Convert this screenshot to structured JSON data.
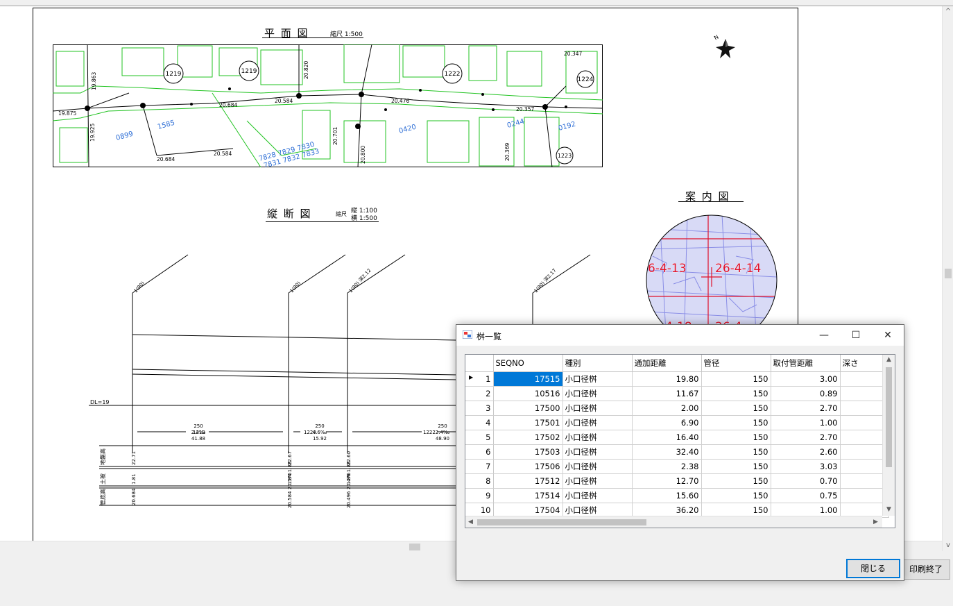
{
  "plan": {
    "title": "平 面 図",
    "scale": "縮尺 1:500",
    "parcels": [
      "1219",
      "1219",
      "1222",
      "1224",
      "1223",
      "1585",
      "0899",
      "0420",
      "0244",
      "0192",
      "7828 7829 7830",
      "7831 7832 7833"
    ],
    "elevations": [
      "20.684",
      "20.584",
      "20.476",
      "20.357",
      "20.347",
      "19.875",
      "19.925",
      "19.863",
      "20.820",
      "20.701",
      "20.800",
      "20.369",
      "20.684",
      "20.584"
    ]
  },
  "guide": {
    "title": "案 内 図",
    "labels": [
      "6-4-13",
      "26-4-14",
      "4-18",
      "26-4-"
    ]
  },
  "profile": {
    "title": "縦 断 図",
    "scale_prefix": "縮尺",
    "scale_v": "縦 1:100",
    "scale_h": "横 1:500",
    "datum": "DL=19",
    "top_labels": [
      "1(90)",
      "1(90)",
      "1(90) 深2.12",
      "1(90) 深2.17"
    ],
    "segments": [
      {
        "id": "1219",
        "dia": "250",
        "grad": "2.4‰",
        "len": "41.88"
      },
      {
        "id": "1220",
        "dia": "250",
        "grad": "4.6‰",
        "len": "15.92"
      },
      {
        "id": "1222",
        "dia": "250",
        "grad": "2.4‰",
        "len": "48.90"
      }
    ],
    "row_labels": [
      "地盤高",
      "土被",
      "管底高"
    ],
    "ground": [
      "22.71",
      "22.67",
      "22.60"
    ],
    "cover": [
      "1.81",
      "1.84 1.88",
      "1.86 1.88"
    ],
    "invert": [
      "20.684",
      "20.584 20.576",
      "20.496 20.476"
    ]
  },
  "dialog": {
    "title": "桝一覧",
    "close_label": "閉じる",
    "columns": [
      "SEQNO",
      "種別",
      "通加距離",
      "管径",
      "取付管距離",
      "深さ"
    ],
    "rows": [
      {
        "n": "1",
        "seq": "17515",
        "type": "小口径桝",
        "dist": "19.80",
        "dia": "150",
        "len": "3.00"
      },
      {
        "n": "2",
        "seq": "10516",
        "type": "小口径桝",
        "dist": "11.67",
        "dia": "150",
        "len": "0.89"
      },
      {
        "n": "3",
        "seq": "17500",
        "type": "小口径桝",
        "dist": "2.00",
        "dia": "150",
        "len": "2.70"
      },
      {
        "n": "4",
        "seq": "17501",
        "type": "小口径桝",
        "dist": "6.90",
        "dia": "150",
        "len": "1.00"
      },
      {
        "n": "5",
        "seq": "17502",
        "type": "小口径桝",
        "dist": "16.40",
        "dia": "150",
        "len": "2.70"
      },
      {
        "n": "6",
        "seq": "17503",
        "type": "小口径桝",
        "dist": "32.40",
        "dia": "150",
        "len": "2.60"
      },
      {
        "n": "7",
        "seq": "17506",
        "type": "小口径桝",
        "dist": "2.38",
        "dia": "150",
        "len": "3.03"
      },
      {
        "n": "8",
        "seq": "17512",
        "type": "小口径桝",
        "dist": "12.70",
        "dia": "150",
        "len": "0.70"
      },
      {
        "n": "9",
        "seq": "17514",
        "type": "小口径桝",
        "dist": "15.60",
        "dia": "150",
        "len": "0.75"
      },
      {
        "n": "10",
        "seq": "17504",
        "type": "小口径桝",
        "dist": "36.20",
        "dia": "150",
        "len": "1.00"
      }
    ]
  },
  "print_end_label": "印刷終了",
  "colors": {
    "map_green": "#22c322",
    "map_blue": "#2f6fd6",
    "guide_red": "#e0102a",
    "guide_blue": "#8a8ee6",
    "selection": "#0078d7"
  }
}
